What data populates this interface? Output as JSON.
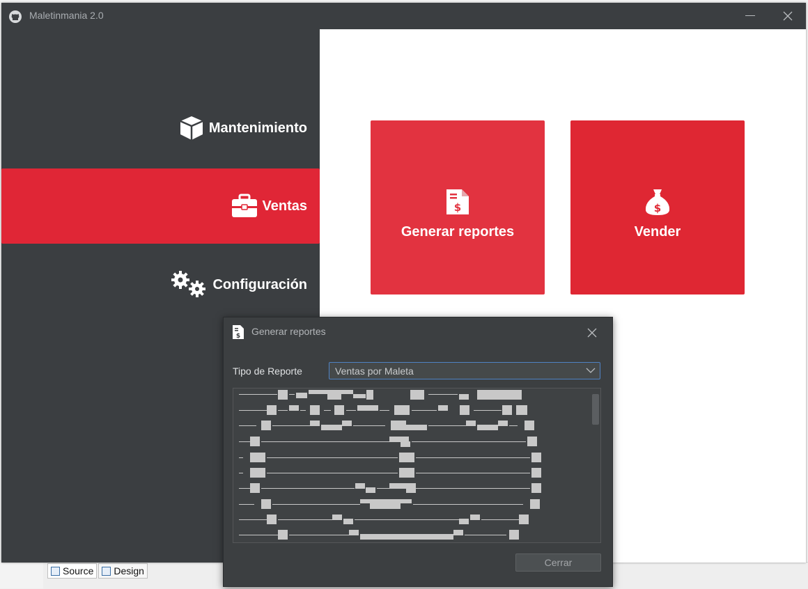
{
  "window": {
    "title": "Maletinmania 2.0"
  },
  "sidebar": {
    "items": [
      {
        "label": "Mantenimiento",
        "icon": "cube-icon",
        "active": false
      },
      {
        "label": "Ventas",
        "icon": "briefcase-icon",
        "active": true
      },
      {
        "label": "Configuración",
        "icon": "gears-icon",
        "active": false
      }
    ]
  },
  "main": {
    "tiles": [
      {
        "label": "Generar reportes",
        "icon": "invoice-dollar-icon"
      },
      {
        "label": "Vender",
        "icon": "money-bag-icon"
      }
    ]
  },
  "dialog": {
    "title": "Generar reportes",
    "field_label": "Tipo de Reporte",
    "select_value": "Ventas por Maleta",
    "close_button": "Cerrar"
  },
  "ide": {
    "tabs": [
      "Source",
      "Design"
    ]
  },
  "colors": {
    "accent_red": "#e02636",
    "tile_red": "#e23340",
    "sidebar_bg": "#3b3e41",
    "dialog_bg": "#3c3f41",
    "select_border": "#4f82c4"
  }
}
